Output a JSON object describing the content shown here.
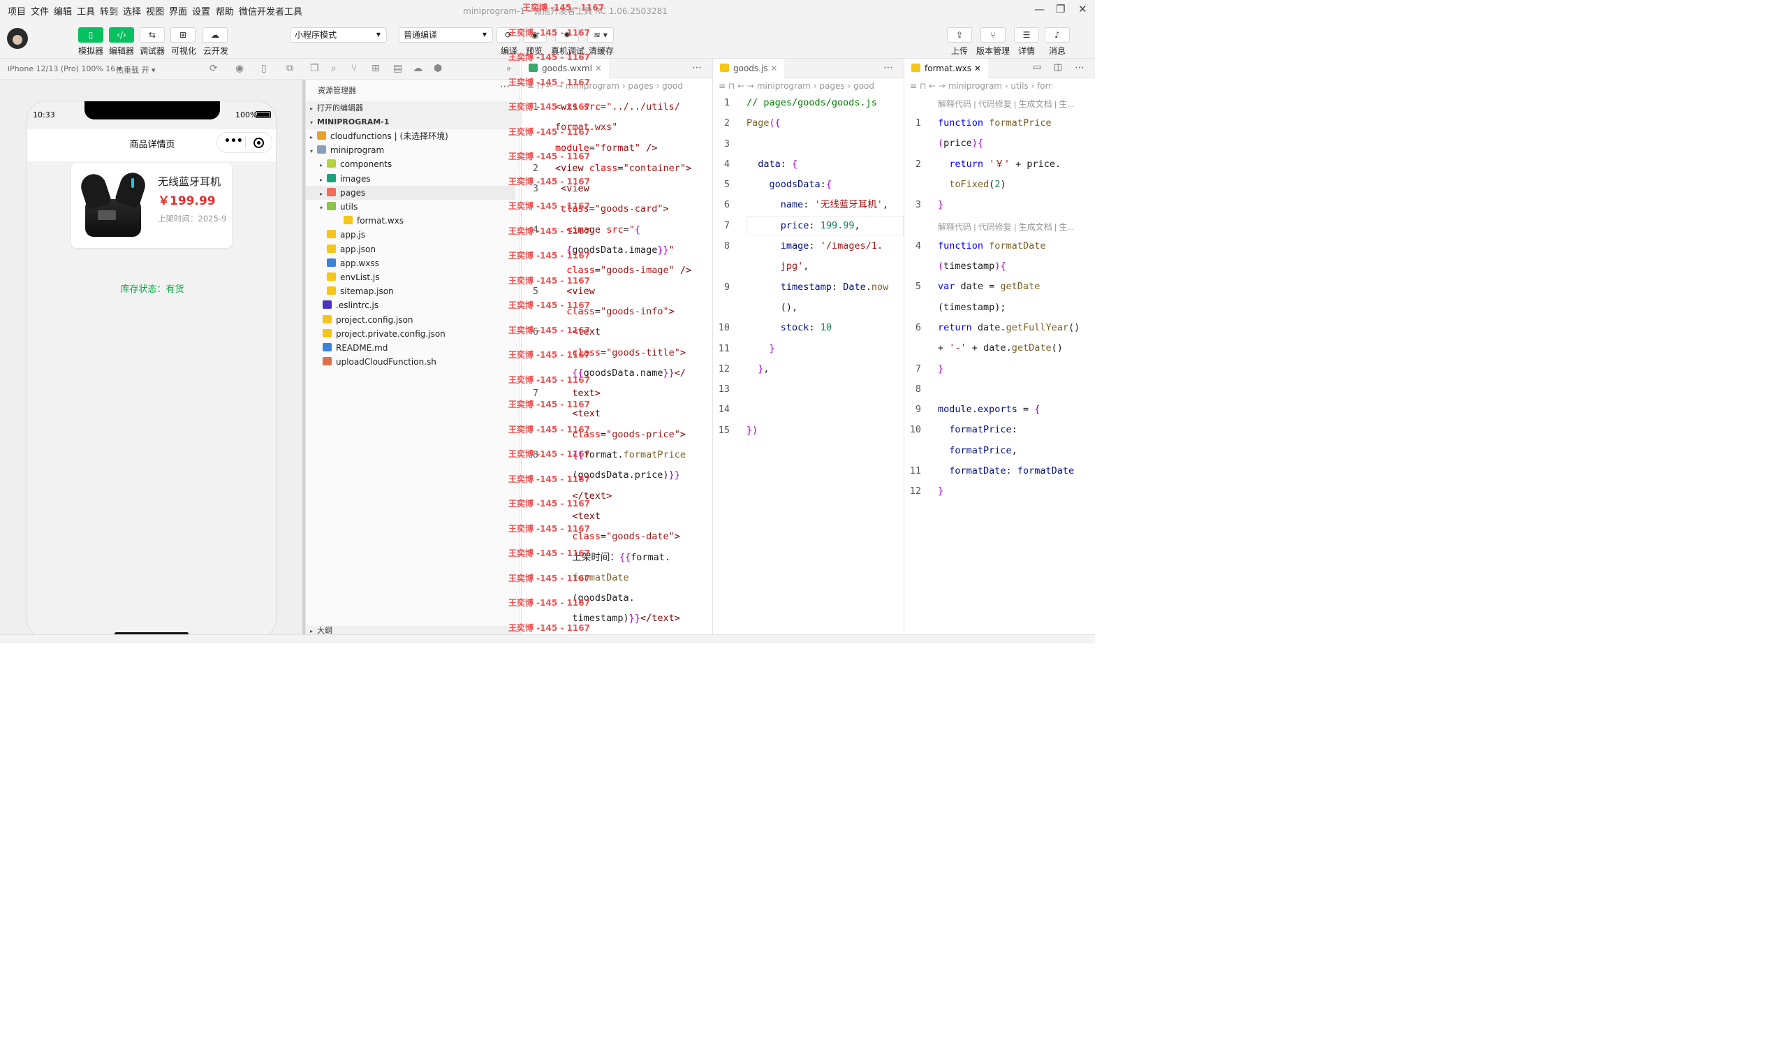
{
  "menu": {
    "items": [
      "项目",
      "文件",
      "编辑",
      "工具",
      "转到",
      "选择",
      "视图",
      "界面",
      "设置",
      "帮助",
      "微信开发者工具"
    ],
    "window_title": "miniprogram-1 - 微信开发者工具 RC 1.06.2503281"
  },
  "toolbar": {
    "left": [
      {
        "label": "模拟器",
        "icon": "phone-icon"
      },
      {
        "label": "编辑器",
        "icon": "code-icon"
      },
      {
        "label": "调试器",
        "icon": "debug-icon"
      },
      {
        "label": "可视化",
        "icon": "layout-icon"
      },
      {
        "label": "云开发",
        "icon": "cloud-icon"
      }
    ],
    "mode_select": "小程序模式",
    "compile_select": "普通编译",
    "center": [
      {
        "label": "编译",
        "icon": "refresh-icon"
      },
      {
        "label": "预览",
        "icon": "eye-icon"
      },
      {
        "label": "真机调试",
        "icon": "bug-icon"
      },
      {
        "label": "清缓存",
        "icon": "layers-icon"
      }
    ],
    "right": [
      {
        "label": "上传",
        "icon": "upload-icon"
      },
      {
        "label": "版本管理",
        "icon": "branch-icon"
      },
      {
        "label": "详情",
        "icon": "menu-icon"
      },
      {
        "label": "消息",
        "icon": "bell-icon"
      }
    ]
  },
  "simulator": {
    "device": "iPhone 12/13 (Pro) 100% 16 ▾",
    "hot_reload": "热重载 开 ▾",
    "time": "10:33",
    "battery": "100%",
    "page_title": "商品详情页",
    "product_name": "无线蓝牙耳机",
    "product_price": "￥199.99",
    "product_date": "上架时间：2025-9",
    "stock": "库存状态：有货"
  },
  "explorer": {
    "title": "资源管理器",
    "open_editors": "打开的编辑器",
    "project": "MINIPROGRAM-1",
    "outline": "大纲",
    "tree": [
      {
        "label": "cloudfunctions | (未选择环境)",
        "depth": 1,
        "caret": "▸",
        "color": "#e8a22b"
      },
      {
        "label": "miniprogram",
        "depth": 1,
        "caret": "▾",
        "color": "#8aa0b8"
      },
      {
        "label": "components",
        "depth": 2,
        "caret": "▸",
        "color": "#b5d43a"
      },
      {
        "label": "images",
        "depth": 2,
        "caret": "▸",
        "color": "#1aa37a"
      },
      {
        "label": "pages",
        "depth": 2,
        "caret": "▸",
        "color": "#f26b5b"
      },
      {
        "label": "utils",
        "depth": 2,
        "caret": "▾",
        "color": "#8bc34a"
      },
      {
        "label": "format.wxs",
        "depth": 3,
        "caret": "",
        "color": "#f5c518"
      },
      {
        "label": "app.js",
        "depth": 2,
        "caret": "",
        "color": "#f5c518"
      },
      {
        "label": "app.json",
        "depth": 2,
        "caret": "",
        "color": "#f5c518"
      },
      {
        "label": "app.wxss",
        "depth": 2,
        "caret": "",
        "color": "#3c82d6"
      },
      {
        "label": "envList.js",
        "depth": 2,
        "caret": "",
        "color": "#f5c518"
      },
      {
        "label": "sitemap.json",
        "depth": 2,
        "caret": "",
        "color": "#f5c518"
      },
      {
        "label": ".eslintrc.js",
        "depth": 1,
        "caret": "",
        "color": "#4b32c3"
      },
      {
        "label": "project.config.json",
        "depth": 1,
        "caret": "",
        "color": "#f5c518"
      },
      {
        "label": "project.private.config.json",
        "depth": 1,
        "caret": "",
        "color": "#f5c518"
      },
      {
        "label": "README.md",
        "depth": 1,
        "caret": "",
        "color": "#3c82d6"
      },
      {
        "label": "uploadCloudFunction.sh",
        "depth": 1,
        "caret": "",
        "color": "#e0704a"
      }
    ]
  },
  "editors": [
    {
      "tab": "goods.wxml",
      "crumb": "miniprogram › pages › good"
    },
    {
      "tab": "goods.js",
      "crumb": "miniprogram › pages › good"
    },
    {
      "tab": "format.wxs",
      "crumb": "miniprogram › utils › forr",
      "codelens": "解释代码 | 代码修复 | 生成文档 | 生..."
    }
  ],
  "watermark": "王奕博 -145 - 1167"
}
